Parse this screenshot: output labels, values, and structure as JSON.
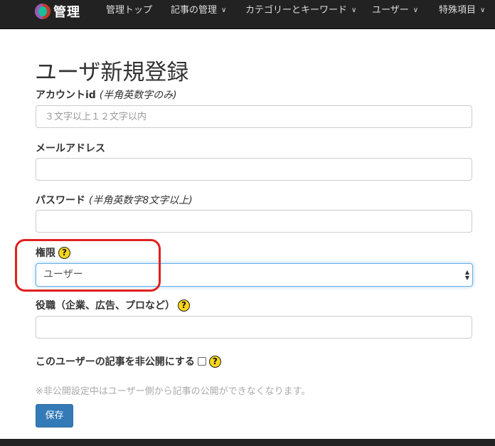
{
  "navbar": {
    "brand": "管理",
    "items": [
      {
        "label": "管理トップ",
        "dropdown": false
      },
      {
        "label": "記事の管理",
        "dropdown": true
      },
      {
        "label": "カテゴリーとキーワード",
        "dropdown": true
      },
      {
        "label": "ユーザー",
        "dropdown": true
      },
      {
        "label": "特殊項目",
        "dropdown": true
      }
    ],
    "caret": "∨"
  },
  "page_title": "ユーザ新規登録",
  "form": {
    "account_id": {
      "label": "アカウントid",
      "note": "(半角英数字のみ)",
      "placeholder": "３文字以上１２文字以内",
      "value": ""
    },
    "email": {
      "label": "メールアドレス",
      "value": ""
    },
    "password": {
      "label": "パスワード",
      "note": "(半角英数字8文字以上)",
      "value": ""
    },
    "role": {
      "label": "権限",
      "selected": "ユーザー"
    },
    "position": {
      "label": "役職（企業、広告、プロなど）",
      "value": ""
    },
    "private": {
      "label": "このユーザーの記事を非公開にする",
      "checked": false
    },
    "help_glyph": "?",
    "note": "※非公開設定中はユーザー側から記事の公開ができなくなります。",
    "save_label": "保存"
  },
  "colors": {
    "navbar_bg": "#222222",
    "primary": "#337ab7",
    "help_icon": "#f7d51a",
    "highlight": "#e02020"
  }
}
